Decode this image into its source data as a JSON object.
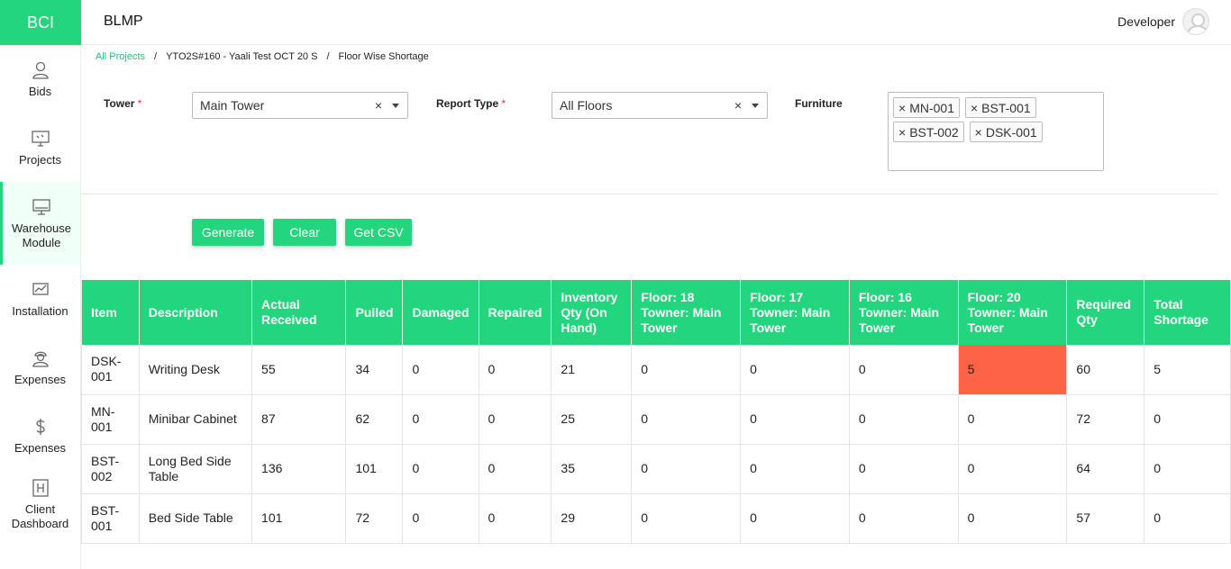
{
  "brand": "BCI",
  "app_title": "BLMP",
  "user": {
    "name": "Developer"
  },
  "sidebar": {
    "items": [
      {
        "label": "Bids",
        "icon": "user-icon"
      },
      {
        "label": "Projects",
        "icon": "monitor-icon"
      },
      {
        "label": "Warehouse Module",
        "icon": "desktop-icon",
        "active": true
      },
      {
        "label": "Installation",
        "icon": "chart-icon"
      },
      {
        "label": "Expenses",
        "icon": "worker-icon"
      },
      {
        "label": "Expenses",
        "icon": "dollar-icon"
      },
      {
        "label": "Client Dashboard",
        "icon": "hospital-icon"
      }
    ]
  },
  "breadcrumb": {
    "root": "All Projects",
    "sep": "/",
    "project": "YTO2S#160 - Yaali Test OCT 20 S",
    "page": "Floor Wise Shortage"
  },
  "filters": {
    "tower_label": "Tower",
    "tower_value": "Main Tower",
    "report_type_label": "Report Type",
    "report_type_value": "All Floors",
    "furniture_label": "Furniture",
    "required_mark": "*",
    "clear_mark": "×",
    "furniture_chips": [
      "MN-001",
      "BST-001",
      "BST-002",
      "DSK-001"
    ]
  },
  "buttons": {
    "generate": "Generate",
    "clear": "Clear",
    "csv": "Get CSV"
  },
  "table": {
    "headers": [
      "Item",
      "Description",
      "Actual Received",
      "Pulled",
      "Damaged",
      "Repaired",
      "Inventory Qty (On Hand)",
      "Floor: 18 Towner: Main Tower",
      "Floor: 17 Towner: Main Tower",
      "Floor: 16 Towner: Main Tower",
      "Floor: 20 Towner: Main Tower",
      "Required Qty",
      "Total Shortage"
    ],
    "rows": [
      [
        "DSK-001",
        "Writing Desk",
        "55",
        "34",
        "0",
        "0",
        "21",
        "0",
        "0",
        "0",
        "5",
        "60",
        "5"
      ],
      [
        "MN-001",
        "Minibar Cabinet",
        "87",
        "62",
        "0",
        "0",
        "25",
        "0",
        "0",
        "0",
        "0",
        "72",
        "0"
      ],
      [
        "BST-002",
        "Long Bed Side Table",
        "136",
        "101",
        "0",
        "0",
        "35",
        "0",
        "0",
        "0",
        "0",
        "64",
        "0"
      ],
      [
        "BST-001",
        "Bed Side Table",
        "101",
        "72",
        "0",
        "0",
        "29",
        "0",
        "0",
        "0",
        "0",
        "57",
        "0"
      ]
    ],
    "highlight": {
      "row": 0,
      "col": 10,
      "color": "#ff6347"
    }
  },
  "colors": {
    "accent": "#23d57c",
    "alert": "#ff6347"
  }
}
